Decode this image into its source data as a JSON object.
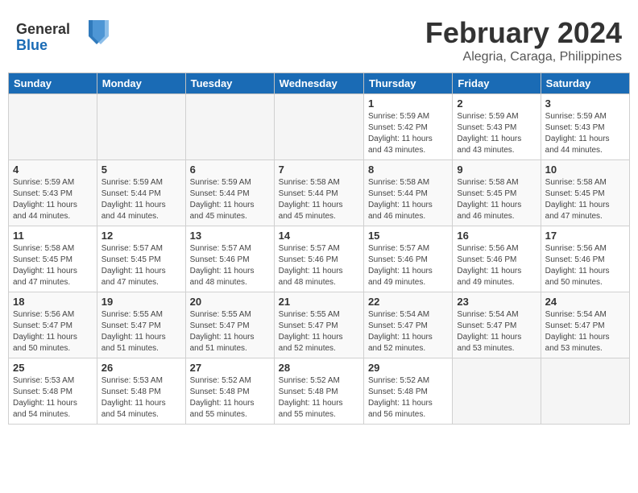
{
  "header": {
    "logo_line1": "General",
    "logo_line2": "Blue",
    "title": "February 2024",
    "subtitle": "Alegria, Caraga, Philippines"
  },
  "columns": [
    "Sunday",
    "Monday",
    "Tuesday",
    "Wednesday",
    "Thursday",
    "Friday",
    "Saturday"
  ],
  "weeks": [
    [
      {
        "day": "",
        "info": ""
      },
      {
        "day": "",
        "info": ""
      },
      {
        "day": "",
        "info": ""
      },
      {
        "day": "",
        "info": ""
      },
      {
        "day": "1",
        "info": "Sunrise: 5:59 AM\nSunset: 5:42 PM\nDaylight: 11 hours\nand 43 minutes."
      },
      {
        "day": "2",
        "info": "Sunrise: 5:59 AM\nSunset: 5:43 PM\nDaylight: 11 hours\nand 43 minutes."
      },
      {
        "day": "3",
        "info": "Sunrise: 5:59 AM\nSunset: 5:43 PM\nDaylight: 11 hours\nand 44 minutes."
      }
    ],
    [
      {
        "day": "4",
        "info": "Sunrise: 5:59 AM\nSunset: 5:43 PM\nDaylight: 11 hours\nand 44 minutes."
      },
      {
        "day": "5",
        "info": "Sunrise: 5:59 AM\nSunset: 5:44 PM\nDaylight: 11 hours\nand 44 minutes."
      },
      {
        "day": "6",
        "info": "Sunrise: 5:59 AM\nSunset: 5:44 PM\nDaylight: 11 hours\nand 45 minutes."
      },
      {
        "day": "7",
        "info": "Sunrise: 5:58 AM\nSunset: 5:44 PM\nDaylight: 11 hours\nand 45 minutes."
      },
      {
        "day": "8",
        "info": "Sunrise: 5:58 AM\nSunset: 5:44 PM\nDaylight: 11 hours\nand 46 minutes."
      },
      {
        "day": "9",
        "info": "Sunrise: 5:58 AM\nSunset: 5:45 PM\nDaylight: 11 hours\nand 46 minutes."
      },
      {
        "day": "10",
        "info": "Sunrise: 5:58 AM\nSunset: 5:45 PM\nDaylight: 11 hours\nand 47 minutes."
      }
    ],
    [
      {
        "day": "11",
        "info": "Sunrise: 5:58 AM\nSunset: 5:45 PM\nDaylight: 11 hours\nand 47 minutes."
      },
      {
        "day": "12",
        "info": "Sunrise: 5:57 AM\nSunset: 5:45 PM\nDaylight: 11 hours\nand 47 minutes."
      },
      {
        "day": "13",
        "info": "Sunrise: 5:57 AM\nSunset: 5:46 PM\nDaylight: 11 hours\nand 48 minutes."
      },
      {
        "day": "14",
        "info": "Sunrise: 5:57 AM\nSunset: 5:46 PM\nDaylight: 11 hours\nand 48 minutes."
      },
      {
        "day": "15",
        "info": "Sunrise: 5:57 AM\nSunset: 5:46 PM\nDaylight: 11 hours\nand 49 minutes."
      },
      {
        "day": "16",
        "info": "Sunrise: 5:56 AM\nSunset: 5:46 PM\nDaylight: 11 hours\nand 49 minutes."
      },
      {
        "day": "17",
        "info": "Sunrise: 5:56 AM\nSunset: 5:46 PM\nDaylight: 11 hours\nand 50 minutes."
      }
    ],
    [
      {
        "day": "18",
        "info": "Sunrise: 5:56 AM\nSunset: 5:47 PM\nDaylight: 11 hours\nand 50 minutes."
      },
      {
        "day": "19",
        "info": "Sunrise: 5:55 AM\nSunset: 5:47 PM\nDaylight: 11 hours\nand 51 minutes."
      },
      {
        "day": "20",
        "info": "Sunrise: 5:55 AM\nSunset: 5:47 PM\nDaylight: 11 hours\nand 51 minutes."
      },
      {
        "day": "21",
        "info": "Sunrise: 5:55 AM\nSunset: 5:47 PM\nDaylight: 11 hours\nand 52 minutes."
      },
      {
        "day": "22",
        "info": "Sunrise: 5:54 AM\nSunset: 5:47 PM\nDaylight: 11 hours\nand 52 minutes."
      },
      {
        "day": "23",
        "info": "Sunrise: 5:54 AM\nSunset: 5:47 PM\nDaylight: 11 hours\nand 53 minutes."
      },
      {
        "day": "24",
        "info": "Sunrise: 5:54 AM\nSunset: 5:47 PM\nDaylight: 11 hours\nand 53 minutes."
      }
    ],
    [
      {
        "day": "25",
        "info": "Sunrise: 5:53 AM\nSunset: 5:48 PM\nDaylight: 11 hours\nand 54 minutes."
      },
      {
        "day": "26",
        "info": "Sunrise: 5:53 AM\nSunset: 5:48 PM\nDaylight: 11 hours\nand 54 minutes."
      },
      {
        "day": "27",
        "info": "Sunrise: 5:52 AM\nSunset: 5:48 PM\nDaylight: 11 hours\nand 55 minutes."
      },
      {
        "day": "28",
        "info": "Sunrise: 5:52 AM\nSunset: 5:48 PM\nDaylight: 11 hours\nand 55 minutes."
      },
      {
        "day": "29",
        "info": "Sunrise: 5:52 AM\nSunset: 5:48 PM\nDaylight: 11 hours\nand 56 minutes."
      },
      {
        "day": "",
        "info": ""
      },
      {
        "day": "",
        "info": ""
      }
    ]
  ]
}
